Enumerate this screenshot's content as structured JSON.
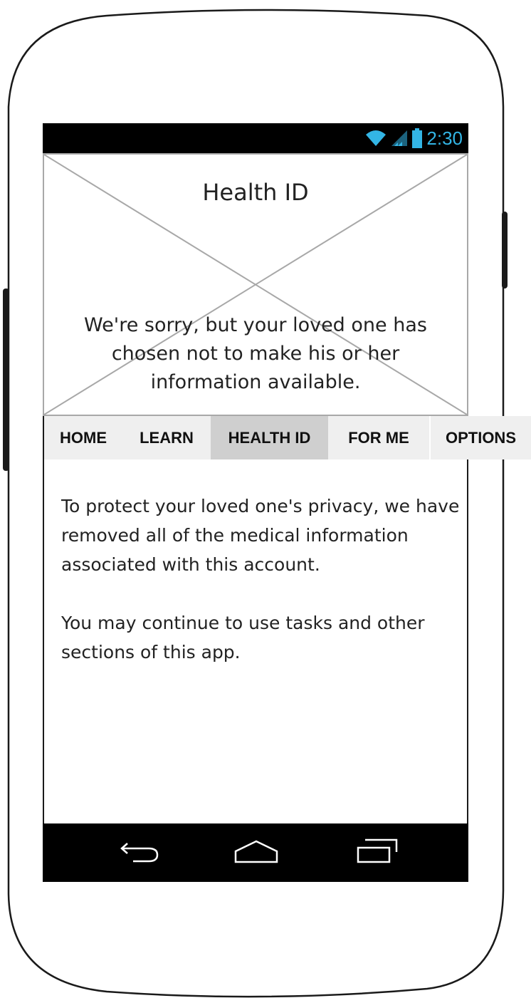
{
  "status_bar": {
    "time": "2:30",
    "time_color": "#33b5e5",
    "icons": [
      "wifi-icon",
      "signal-icon",
      "battery-icon"
    ]
  },
  "header": {
    "title": "Health ID",
    "message": "We're sorry, but your loved one has chosen not to make his or her information available."
  },
  "tabs": [
    {
      "label": "HOME",
      "active": false
    },
    {
      "label": "LEARN",
      "active": false
    },
    {
      "label": "HEALTH ID",
      "active": true
    },
    {
      "label": "FOR ME",
      "active": false
    },
    {
      "label": "OPTIONS",
      "active": false
    }
  ],
  "body": {
    "paragraph_1": "To protect your loved one's privacy, we have removed all of the medical information associated with this account.",
    "paragraph_2": "You may continue to use tasks and other sections of this app."
  },
  "nav_bar": {
    "buttons": [
      "back-icon",
      "home-icon",
      "recent-apps-icon"
    ]
  },
  "colors": {
    "tab_active": "#cfcfcf",
    "tab_inactive": "#efefef",
    "bars": "#000000"
  }
}
